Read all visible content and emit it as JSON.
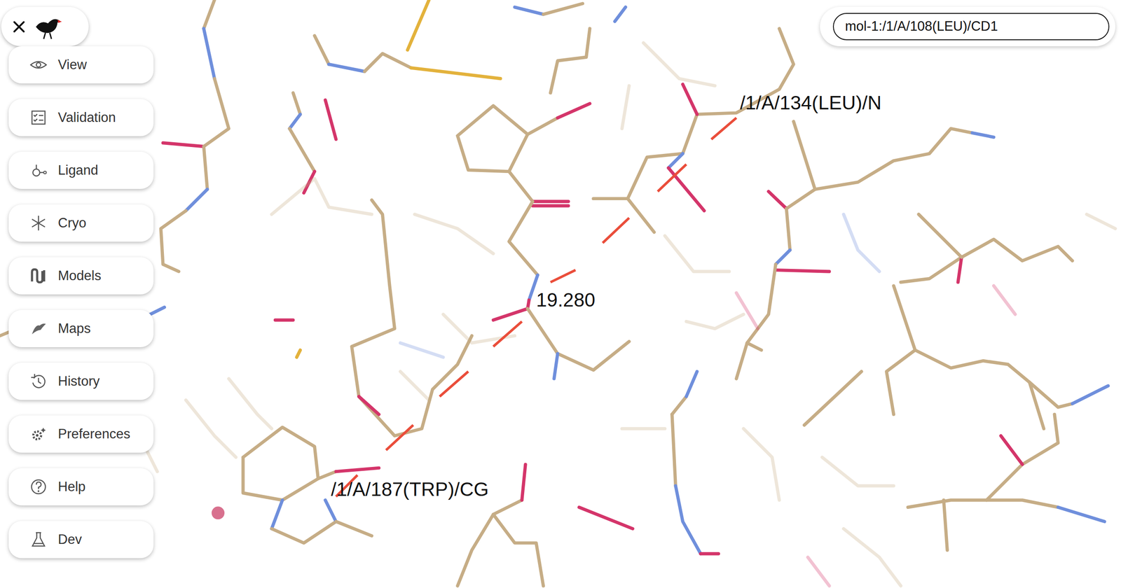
{
  "sidebar": {
    "items": [
      {
        "label": "View"
      },
      {
        "label": "Validation"
      },
      {
        "label": "Ligand"
      },
      {
        "label": "Cryo"
      },
      {
        "label": "Models"
      },
      {
        "label": "Maps"
      },
      {
        "label": "History"
      },
      {
        "label": "Preferences"
      },
      {
        "label": "Help"
      },
      {
        "label": "Dev"
      }
    ]
  },
  "search": {
    "value": "mol-1:/1/A/108(LEU)/CD1"
  },
  "canvas": {
    "atom_labels": [
      {
        "text": "/1/A/134(LEU)/N"
      },
      {
        "text": "/1/A/187(TRP)/CG"
      }
    ],
    "distance": "19.280"
  }
}
